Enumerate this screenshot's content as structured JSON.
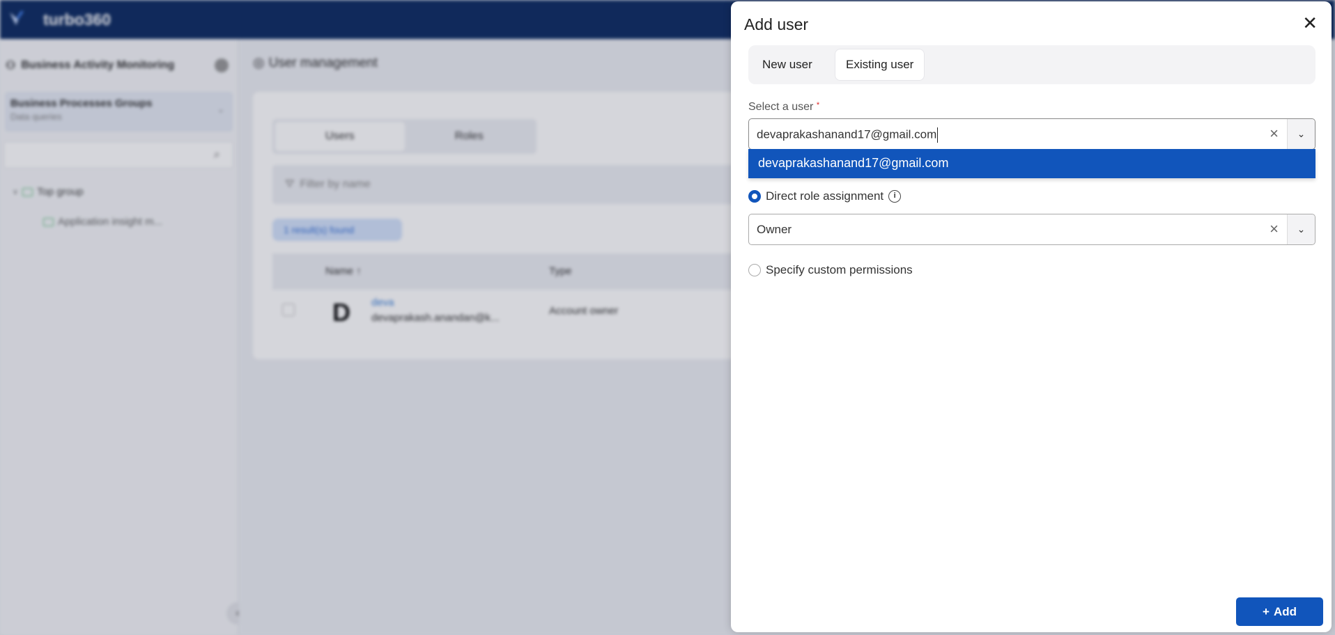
{
  "app": {
    "brand": "turbo360",
    "header_color": "#0f2d63",
    "accent": "#1155bb"
  },
  "sidebar": {
    "title": "Business Activity Monitoring",
    "group_title": "Business Processes Groups",
    "group_subtitle": "Data queries",
    "tree": [
      {
        "label": "Top group"
      },
      {
        "label": "Application insight m..."
      }
    ]
  },
  "main": {
    "title": "User management",
    "tabs": [
      {
        "label": "Users"
      },
      {
        "label": "Roles"
      }
    ],
    "filter_placeholder": "Filter by name",
    "results": "1 result(s) found",
    "columns": [
      "Name",
      "Type"
    ],
    "rows": [
      {
        "avatar": "D",
        "name": "deva",
        "email": "devaprakash.anandan@k...",
        "type": "Account owner"
      }
    ]
  },
  "dialog": {
    "title": "Add user",
    "tabs": [
      {
        "label": "New user"
      },
      {
        "label": "Existing user",
        "active": true
      }
    ],
    "select_label": "Select a user",
    "required_mark": "*",
    "select_value": "devaprakashanand17@gmail.com",
    "options": [
      "devaprakashanand17@gmail.com"
    ],
    "radio_direct": "Direct role assignment",
    "role_value": "Owner",
    "radio_custom": "Specify custom permissions",
    "add_label": "Add"
  }
}
